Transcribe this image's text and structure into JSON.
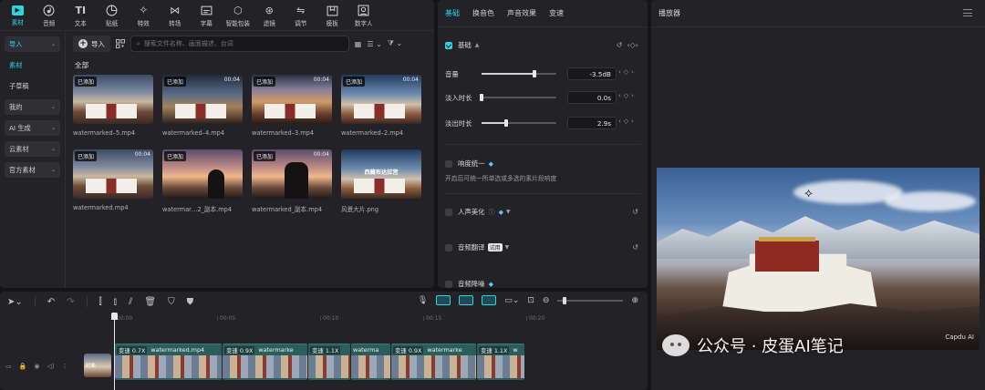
{
  "toolbar": {
    "items": [
      {
        "label": "素材",
        "icon": "media-icon",
        "active": true
      },
      {
        "label": "音频",
        "icon": "audio-icon"
      },
      {
        "label": "文本",
        "icon": "text-icon"
      },
      {
        "label": "贴纸",
        "icon": "sticker-icon"
      },
      {
        "label": "特效",
        "icon": "effects-icon"
      },
      {
        "label": "转场",
        "icon": "transition-icon"
      },
      {
        "label": "字幕",
        "icon": "subtitle-icon"
      },
      {
        "label": "智能包装",
        "icon": "smart-package-icon"
      },
      {
        "label": "滤镜",
        "icon": "filter-icon"
      },
      {
        "label": "调节",
        "icon": "adjust-icon"
      },
      {
        "label": "模板",
        "icon": "template-icon"
      },
      {
        "label": "数字人",
        "icon": "digital-human-icon"
      }
    ]
  },
  "sidebar": {
    "items": [
      {
        "label": "导入",
        "chevron": "⌄",
        "style": "box accent"
      },
      {
        "label": "素材",
        "style": "accent"
      },
      {
        "label": "子草稿",
        "style": ""
      },
      {
        "label": "我的",
        "chevron": "⌄",
        "style": "box"
      },
      {
        "label": "AI 生成",
        "chevron": "⌄",
        "style": "box"
      },
      {
        "label": "云素材",
        "chevron": "⌄",
        "style": "box"
      },
      {
        "label": "官方素材",
        "chevron": "⌄",
        "style": "box"
      }
    ]
  },
  "media": {
    "import_label": "导入",
    "search_placeholder": "搜索文件名称、画面描述、台词",
    "all_label": "全部",
    "thumbnails": [
      {
        "name": "watermarked–5.mp4",
        "added": "已添加",
        "duration": "",
        "scene": "scene-a"
      },
      {
        "name": "watermarked–4.mp4",
        "added": "已添加",
        "duration": "00:04",
        "scene": "scene-b"
      },
      {
        "name": "watermarked–3.mp4",
        "added": "已添加",
        "duration": "00:04",
        "scene": "scene-c"
      },
      {
        "name": "watermarked–2.mp4",
        "added": "已添加",
        "duration": "00:04",
        "scene": "scene-d"
      },
      {
        "name": "watermarked.mp4",
        "added": "已添加",
        "duration": "00:04",
        "scene": "scene-a"
      },
      {
        "name": "watermar…2_副本.mp4",
        "added": "已添加",
        "duration": "",
        "scene": "scene-e"
      },
      {
        "name": "watermarked_副本.mp4",
        "added": "已添加",
        "duration": "00:04",
        "scene": "scene-e"
      },
      {
        "name": "风景大片.png",
        "added": "",
        "duration": "",
        "scene": "scene-d",
        "caption": "西藏布达拉宫"
      }
    ]
  },
  "props": {
    "tabs": [
      "基础",
      "换音色",
      "声音效果",
      "变速"
    ],
    "basic_label": "基础",
    "volume_label": "音量",
    "volume_value": "-3.5dB",
    "volume_fraction": 0.71,
    "fadein_label": "淡入时长",
    "fadein_value": "0.0s",
    "fadein_fraction": 0.0,
    "fadeout_label": "淡出时长",
    "fadeout_value": "2.9s",
    "fadeout_fraction": 0.33,
    "loudness_label": "响度统一",
    "loudness_desc": "开启后可统一所单选或多选的素片段响度",
    "voice_beauty_label": "人声美化",
    "translate_label": "音频翻译",
    "trial_badge": "试用",
    "denoise_label": "音频降噪"
  },
  "player": {
    "title": "播放器",
    "corner_text": "Capdu AI"
  },
  "watermark": {
    "text": "公众号 · 皮蛋AI笔记"
  },
  "timeline": {
    "ruler": [
      "00:00",
      "00:05",
      "00:10",
      "00:15",
      "00:20"
    ],
    "cover_label": "封面",
    "clips": [
      {
        "speed": "变速 0.7X",
        "name": "watermarked.mp4",
        "width": 117
      },
      {
        "speed": "变速 0.9X",
        "name": "watermarke",
        "width": 93
      },
      {
        "speed": "变速 1.1X",
        "name": "",
        "width": 46
      },
      {
        "speed": "",
        "name": "waterma",
        "width": 43
      },
      {
        "speed": "变速 0.9X",
        "name": "watermarke",
        "width": 93
      },
      {
        "speed": "变速 1.1X",
        "name": "w",
        "width": 52
      }
    ]
  },
  "colors": {
    "accent": "#2fd4df",
    "panel": "#232327",
    "background": "#151518"
  }
}
